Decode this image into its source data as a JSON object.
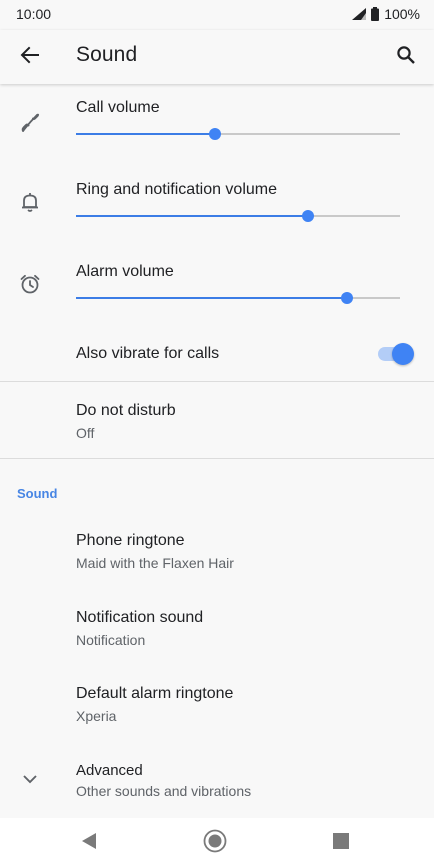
{
  "status_bar": {
    "time": "10:00",
    "battery": "100%"
  },
  "app_bar": {
    "title": "Sound",
    "back_icon": "arrow-back-icon",
    "search_icon": "search-icon"
  },
  "volume_sliders": [
    {
      "label": "Call volume",
      "icon": "phone-handset-icon",
      "level": 0.43
    },
    {
      "label": "Ring and notification volume",
      "icon": "bell-icon",
      "level": 0.715
    },
    {
      "label": "Alarm volume",
      "icon": "alarm-clock-icon",
      "level": 0.835
    }
  ],
  "vibrate": {
    "label": "Also vibrate for calls",
    "enabled": true
  },
  "do_not_disturb": {
    "title": "Do not disturb",
    "value": "Off"
  },
  "section": {
    "header": "Sound"
  },
  "sound_items": [
    {
      "title": "Phone ringtone",
      "value": "Maid with the Flaxen Hair"
    },
    {
      "title": "Notification sound",
      "value": "Notification"
    },
    {
      "title": "Default alarm ringtone",
      "value": "Xperia"
    }
  ],
  "advanced": {
    "title": "Advanced",
    "summary": "Other sounds and vibrations",
    "icon": "chevron-down-icon"
  },
  "nav_bar": {
    "back_icon": "nav-back-icon",
    "home_icon": "nav-home-icon",
    "recents_icon": "nav-recents-icon"
  },
  "colors": {
    "accent": "#3f83f4",
    "section_header": "#4785e4",
    "background": "#f8f8f8"
  }
}
